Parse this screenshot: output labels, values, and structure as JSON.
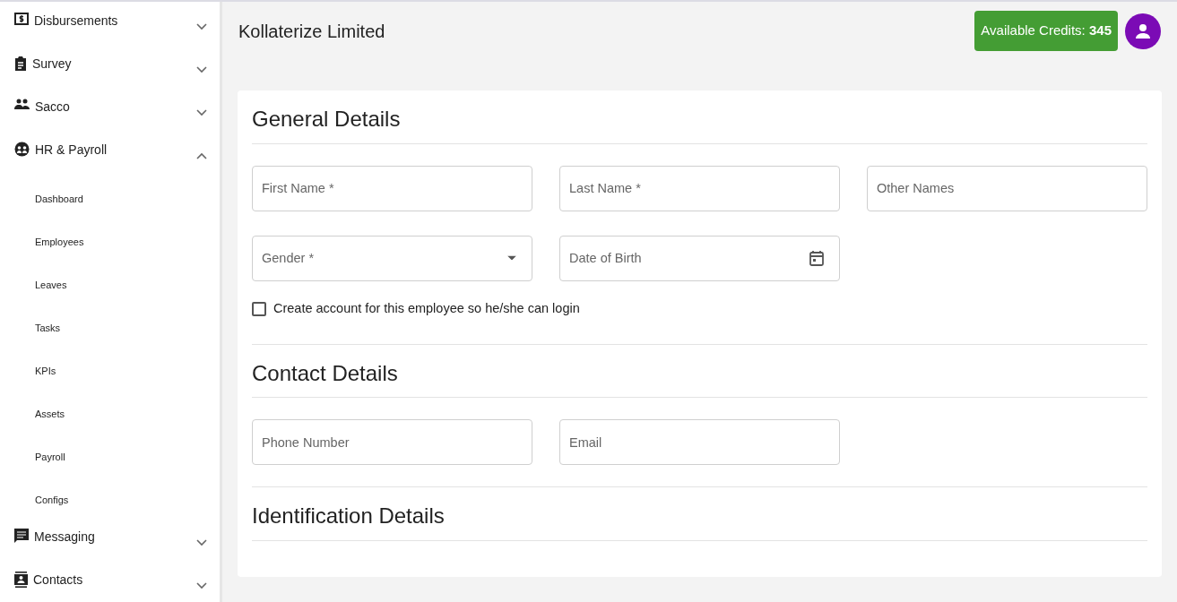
{
  "sidebar": {
    "items": [
      {
        "label": "Disbursements",
        "expanded": false
      },
      {
        "label": "Survey",
        "expanded": false
      },
      {
        "label": "Sacco",
        "expanded": false
      },
      {
        "label": "HR & Payroll",
        "expanded": true,
        "children": [
          {
            "label": "Dashboard"
          },
          {
            "label": "Employees"
          },
          {
            "label": "Leaves"
          },
          {
            "label": "Tasks"
          },
          {
            "label": "KPIs"
          },
          {
            "label": "Assets"
          },
          {
            "label": "Payroll"
          },
          {
            "label": "Configs"
          }
        ]
      },
      {
        "label": "Messaging",
        "expanded": false
      },
      {
        "label": "Contacts",
        "expanded": false
      }
    ]
  },
  "header": {
    "title": "Kollaterize Limited",
    "credits": "Available Credits: **345**"
  },
  "form": {
    "sections": [
      {
        "title": "General Details",
        "rows": [
          [
            {
              "kind": "text",
              "placeholder": "First Name *"
            },
            {
              "kind": "text",
              "placeholder": "Last Name *"
            },
            {
              "kind": "text",
              "placeholder": "Other Names"
            }
          ],
          [
            {
              "kind": "select",
              "placeholder": "Gender *"
            },
            {
              "kind": "date",
              "placeholder": "Date of Birth"
            }
          ]
        ],
        "checkbox": {
          "label": "Create account for this employee so he/she can login",
          "checked": false
        }
      },
      {
        "title": "Contact Details",
        "rows": [
          [
            {
              "kind": "text",
              "placeholder": "Phone Number"
            },
            {
              "kind": "text",
              "placeholder": "Email"
            }
          ]
        ]
      },
      {
        "title": "Identification Details"
      }
    ]
  }
}
